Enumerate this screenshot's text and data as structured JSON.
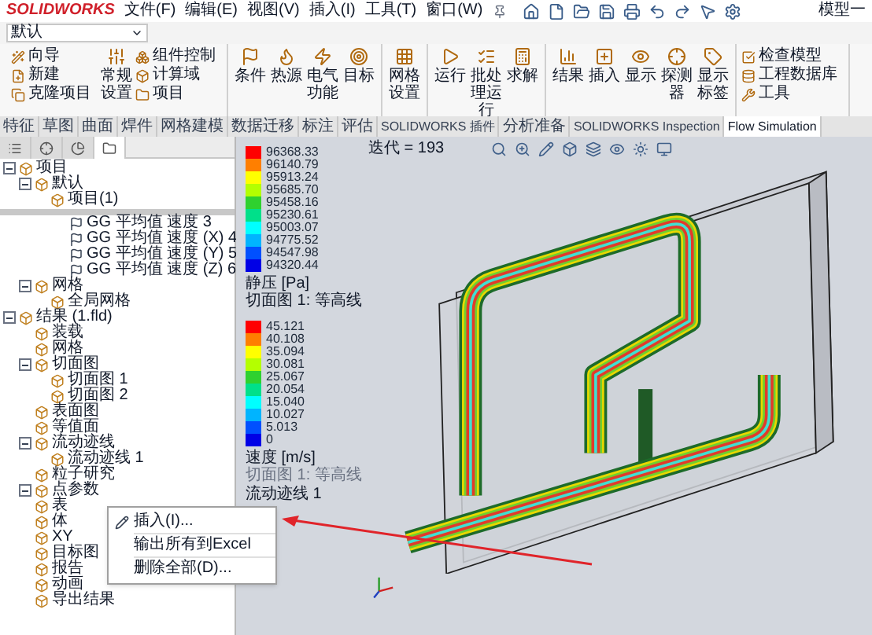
{
  "app": {
    "logo": "SOLIDWORKS",
    "menus": [
      "文件(F)",
      "编辑(E)",
      "视图(V)",
      "插入(I)",
      "工具(T)",
      "窗口(W)"
    ],
    "document": "模型一"
  },
  "config": {
    "value": "默认"
  },
  "ribbon": {
    "groups": [
      [
        {
          "kind": "stack",
          "items": [
            "向导",
            "新建",
            "克隆项目"
          ]
        },
        {
          "kind": "large",
          "label": "常规设置"
        },
        {
          "kind": "stack",
          "items": [
            "组件控制",
            "计算域",
            "项目"
          ]
        }
      ],
      [
        {
          "kind": "large",
          "label": "条件"
        },
        {
          "kind": "large",
          "label": "热源"
        },
        {
          "kind": "large",
          "label": "电气功能"
        },
        {
          "kind": "large",
          "label": "目标"
        }
      ],
      [
        {
          "kind": "large",
          "label": "网格设置"
        }
      ],
      [
        {
          "kind": "large",
          "label": "运行"
        },
        {
          "kind": "large",
          "label": "批处理运行"
        },
        {
          "kind": "large",
          "label": "求解"
        }
      ],
      [
        {
          "kind": "large",
          "label": "结果"
        },
        {
          "kind": "large",
          "label": "插入"
        },
        {
          "kind": "large",
          "label": "显示"
        },
        {
          "kind": "large",
          "label": "探测器"
        },
        {
          "kind": "large",
          "label": "显示标签"
        }
      ],
      [
        {
          "kind": "stack",
          "items": [
            "检查模型",
            "工程数据库",
            "工具"
          ]
        }
      ]
    ]
  },
  "tabs": [
    {
      "label": "特征",
      "selected": false
    },
    {
      "label": "草图",
      "selected": false
    },
    {
      "label": "曲面",
      "selected": false
    },
    {
      "label": "焊件",
      "selected": false
    },
    {
      "label": "网格建模",
      "selected": false
    },
    {
      "label": "数据迁移",
      "selected": false
    },
    {
      "label": "标注",
      "selected": false
    },
    {
      "label": "评估",
      "selected": false
    },
    {
      "label": "SOLIDWORKS 插件",
      "selected": false
    },
    {
      "label": "分析准备",
      "selected": false
    },
    {
      "label": "SOLIDWORKS Inspection",
      "selected": false
    },
    {
      "label": "Flow Simulation",
      "selected": true
    }
  ],
  "panel_tabs": [
    {
      "selected": false
    },
    {
      "selected": false
    },
    {
      "selected": false
    },
    {
      "selected": true
    }
  ],
  "tree_top": [
    {
      "label": "项目",
      "expanded": true,
      "children": [
        {
          "label": "默认",
          "expanded": true,
          "children": [
            {
              "label": "项目(1)"
            }
          ]
        }
      ]
    }
  ],
  "goals": [
    "GG 平均值 速度 3",
    "GG 平均值 速度 (X) 4",
    "GG 平均值 速度 (Y) 5",
    "GG 平均值 速度 (Z) 6"
  ],
  "tree": [
    {
      "label": "网格",
      "expanded": true,
      "children": [
        {
          "label": "全局网格"
        }
      ]
    },
    {
      "label": "结果 (1.fld)",
      "expanded": true,
      "children": [
        {
          "label": "装载"
        },
        {
          "label": "网格"
        },
        {
          "label": "切面图",
          "expanded": true,
          "children": [
            {
              "label": "切面图 1"
            },
            {
              "label": "切面图 2"
            }
          ]
        },
        {
          "label": "表面图"
        },
        {
          "label": "等值面"
        },
        {
          "label": "流动迹线",
          "expanded": true,
          "children": [
            {
              "label": "流动迹线 1"
            }
          ]
        },
        {
          "label": "粒子研究"
        },
        {
          "label": "点参数",
          "expanded": true
        },
        {
          "label": "表"
        },
        {
          "label": "体"
        },
        {
          "label": "XY"
        },
        {
          "label": "目标图"
        },
        {
          "label": "报告"
        },
        {
          "label": "动画"
        },
        {
          "label": "导出结果"
        }
      ]
    }
  ],
  "context_menu": {
    "items": [
      "插入(I)...",
      "输出所有到Excel",
      "删除全部(D)..."
    ]
  },
  "viewport": {
    "iteration": "迭代 = 193",
    "legends": [
      {
        "values": [
          "96368.33",
          "96140.79",
          "95913.24",
          "95685.70",
          "95458.16",
          "95230.61",
          "95003.07",
          "94775.52",
          "94547.98",
          "94320.44"
        ],
        "title": "静压 [Pa]",
        "notes": [
          "切面图 1: 等高线"
        ]
      },
      {
        "values": [
          "45.121",
          "40.108",
          "35.094",
          "30.081",
          "25.067",
          "20.054",
          "15.040",
          "10.027",
          "5.013",
          "0"
        ],
        "title": "速度 [m/s]",
        "notes": [
          "切面图 1: 等高线",
          "流动迹线 1"
        ]
      }
    ]
  }
}
